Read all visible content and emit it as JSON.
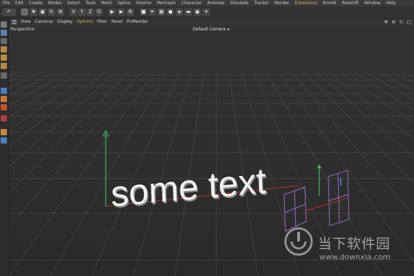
{
  "menubar": {
    "items": [
      "File",
      "Edit",
      "Create",
      "Modes",
      "Select",
      "Tools",
      "Mesh",
      "Spline",
      "Volume",
      "MoGraph",
      "Character",
      "Animate",
      "Simulate",
      "Tracker",
      "Render",
      "Extensions",
      "Arnold",
      "Redshift",
      "Window",
      "Help"
    ],
    "accent_item": "Extensions"
  },
  "toolbar": {
    "x_label": "X",
    "y_label": "Y",
    "z_label": "Z"
  },
  "viewport_menu": {
    "items": [
      "View",
      "Cameras",
      "Display",
      "Options",
      "Filter",
      "Panel",
      "ProRender"
    ],
    "accent_item": "Options",
    "nav_icons": [
      "move-icon",
      "zoom-icon",
      "rotate-icon",
      "maximize-icon"
    ]
  },
  "viewport": {
    "label": "Perspective",
    "camera": "Default Camera",
    "camera_icon": "camera-target-icon",
    "scene_text": "some text"
  },
  "watermark": {
    "title": "当下软件园",
    "url": "www.downxia.com"
  },
  "colors": {
    "background": "#2f2f2f",
    "accent": "#e0b35a",
    "y_axis": "#3ec05a",
    "x_axis": "#c8302a",
    "selection": "#a06ad0"
  }
}
